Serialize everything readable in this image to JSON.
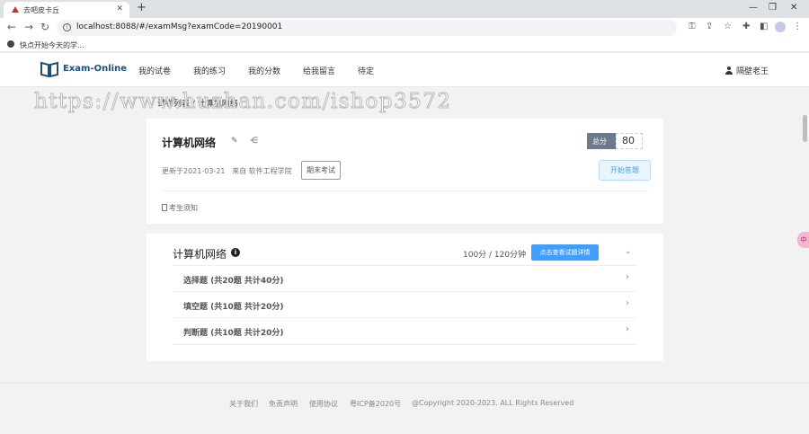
{
  "browser": {
    "tab_title": "去吧皮卡丘",
    "new_tab": "+",
    "url": "localhost:8088/#/examMsg?examCode=20190001",
    "bookmark": "快点开始今天的学..."
  },
  "header": {
    "logo_text": "Exam-Online",
    "nav": [
      "我的试卷",
      "我的练习",
      "我的分数",
      "给我留言",
      "待定"
    ],
    "user_name": "隔壁老王"
  },
  "watermark": "https://www.huzhan.com/ishop3572",
  "breadcrumb": "试卷列表 / 计算机网络",
  "exam": {
    "title": "计算机网络",
    "score_label": "总分",
    "score_value": "80",
    "updated": "更新于2021-03-21",
    "source": "来自 软件工程学院",
    "tag": "期末考试",
    "start_button": "开始答题",
    "notice": "考生须知"
  },
  "detail": {
    "title": "计算机网络",
    "info_icon": "i",
    "duration": "100分 / 120分钟",
    "detail_button": "点击查看试题详情",
    "sections": [
      {
        "label": "选择题 (共20题 共计40分)"
      },
      {
        "label": "填空题 (共10题 共计20分)"
      },
      {
        "label": "判断题 (共10题 共计20分)"
      }
    ]
  },
  "footer": {
    "about": "关于我们",
    "disclaimer": "免责声明",
    "terms": "使用协议",
    "icp": "粤ICP备2020号",
    "copyright": "@Copyright 2020-2023. ALL Rights Reserved"
  },
  "float_text": "中",
  "colors": {
    "primary": "#409eff",
    "logo": "#1f4e79",
    "score_label_bg": "#6b7a8f"
  }
}
